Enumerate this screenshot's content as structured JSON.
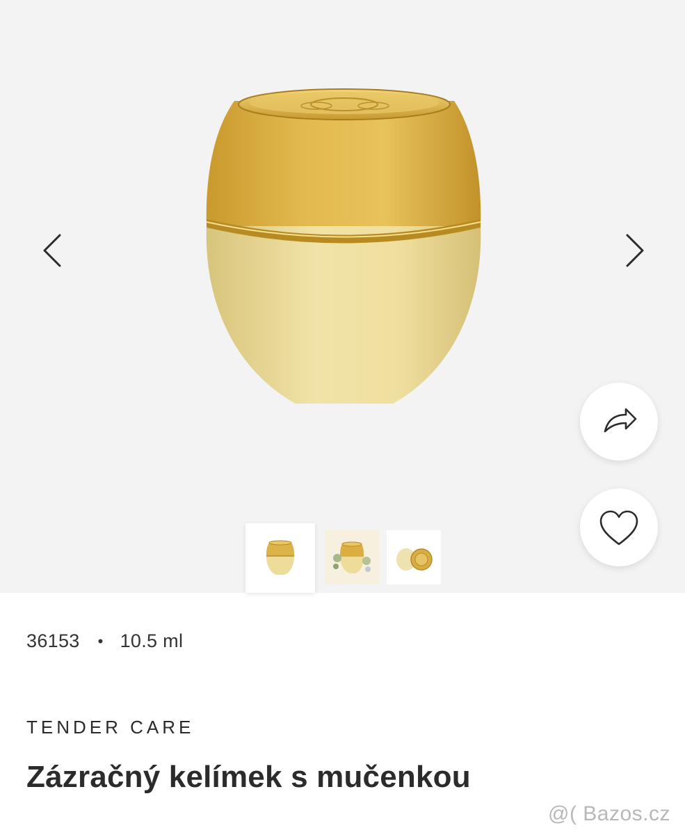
{
  "product": {
    "code": "36153",
    "separator": "•",
    "volume": "10.5 ml",
    "brand": "TENDER CARE",
    "title": "Zázračný kelímek s mučenkou"
  },
  "gallery": {
    "prev_icon": "chevron-left-icon",
    "next_icon": "chevron-right-icon",
    "share_icon": "share-arrow-icon",
    "favorite_icon": "heart-outline-icon",
    "thumbnail_count": 3,
    "active_thumbnail": 1
  },
  "watermark": "@( Bazos.cz",
  "colors": {
    "gallery_bg": "#f3f3f4",
    "lid_gold": "#dcb24a",
    "base_cream": "#ecdc9c",
    "rim_gold": "#c9a23a",
    "text": "#2b2b2b"
  }
}
